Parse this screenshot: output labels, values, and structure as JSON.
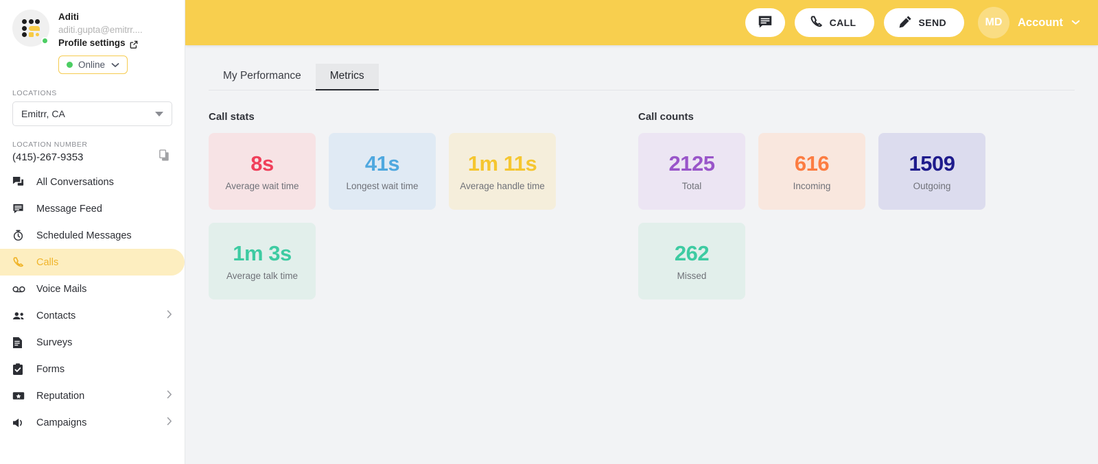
{
  "sidebar": {
    "profile": {
      "name": "Aditi",
      "email": "aditi.gupta@emitrr....",
      "settings_label": "Profile settings",
      "status_label": "Online",
      "status_color": "#4ccd63"
    },
    "locations_label": "LOCATIONS",
    "location_selected": "Emitrr, CA",
    "location_number_label": "LOCATION NUMBER",
    "location_number": "(415)-267-9353",
    "nav_items": [
      {
        "label": "All Conversations",
        "icon": "conversations-icon",
        "active": false,
        "chevron": false
      },
      {
        "label": "Message Feed",
        "icon": "message-feed-icon",
        "active": false,
        "chevron": false
      },
      {
        "label": "Scheduled Messages",
        "icon": "clock-icon",
        "active": false,
        "chevron": false
      },
      {
        "label": "Calls",
        "icon": "phone-icon",
        "active": true,
        "chevron": false
      },
      {
        "label": "Voice Mails",
        "icon": "voicemail-icon",
        "active": false,
        "chevron": false
      },
      {
        "label": "Contacts",
        "icon": "contacts-icon",
        "active": false,
        "chevron": true
      },
      {
        "label": "Surveys",
        "icon": "document-icon",
        "active": false,
        "chevron": false
      },
      {
        "label": "Forms",
        "icon": "clipboard-check-icon",
        "active": false,
        "chevron": false
      },
      {
        "label": "Reputation",
        "icon": "star-badge-icon",
        "active": false,
        "chevron": true
      },
      {
        "label": "Campaigns",
        "icon": "megaphone-icon",
        "active": false,
        "chevron": true
      }
    ]
  },
  "topbar": {
    "background": "#f8cf4e",
    "message_button": "",
    "call_button": "CALL",
    "send_button": "SEND",
    "account_initials": "MD",
    "account_label": "Account"
  },
  "tabs": [
    {
      "label": "My Performance",
      "active": false
    },
    {
      "label": "Metrics",
      "active": true
    }
  ],
  "call_stats": {
    "title": "Call stats",
    "cards": [
      {
        "value": "8s",
        "label": "Average wait time",
        "value_color": "#f03f5a",
        "bg": "#f7e3e5"
      },
      {
        "value": "41s",
        "label": "Longest wait time",
        "value_color": "#4fa8df",
        "bg": "#e0eaf4"
      },
      {
        "value": "1m 11s",
        "label": "Average handle time",
        "value_color": "#f5c630",
        "bg": "#f5eedb"
      },
      {
        "value": "1m 3s",
        "label": "Average talk time",
        "value_color": "#3ecba2",
        "bg": "#e2efeb"
      }
    ]
  },
  "call_counts": {
    "title": "Call counts",
    "cards": [
      {
        "value": "2125",
        "label": "Total",
        "value_color": "#9955c9",
        "bg": "#ece5f3"
      },
      {
        "value": "616",
        "label": "Incoming",
        "value_color": "#fc7d42",
        "bg": "#f9e7de"
      },
      {
        "value": "1509",
        "label": "Outgoing",
        "value_color": "#1e1b8c",
        "bg": "#dcdcee"
      },
      {
        "value": "262",
        "label": "Missed",
        "value_color": "#3ecba2",
        "bg": "#e2efeb"
      }
    ]
  }
}
